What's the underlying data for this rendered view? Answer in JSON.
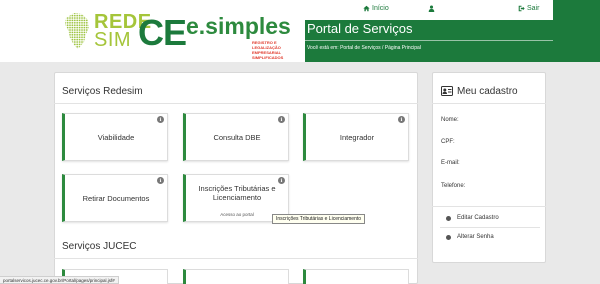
{
  "header": {
    "logo": {
      "rede": "REDE",
      "sim": "SIM",
      "ce": "CE",
      "esimples": "e.simples",
      "esimples_sub": "REGISTRO E LEGALIZAÇÃO EMPRESARIAL SIMPLIFICADOS"
    },
    "topbar": {
      "home_label": "Início",
      "logout_label": "Sair"
    },
    "portal_title": "Portal de Serviços",
    "breadcrumb": "Você está em: Portal de Serviços / Página Principal"
  },
  "main": {
    "section1_title": "Serviços Redesim",
    "cards": [
      {
        "label": "Viabilidade"
      },
      {
        "label": "Consulta DBE"
      },
      {
        "label": "Integrador"
      },
      {
        "label": "Retirar Documentos"
      },
      {
        "label": "Inscrições Tributárias e Licenciamento",
        "sub": "Acesso ao portal"
      }
    ],
    "tooltip": "Inscrições Tributárias e Licenciamento",
    "section2_title": "Serviços JUCEC"
  },
  "side": {
    "title": "Meu cadastro",
    "fields": {
      "name": "Nome:",
      "cpf": "CPF:",
      "email": "E-mail:",
      "phone": "Telefone:"
    },
    "links": {
      "edit": "Editar Cadastro",
      "password": "Alterar Senha"
    }
  },
  "status_url": "portalservicos.jucec.ce.gov.br/Portal/pages/principal.jsf#",
  "colors": {
    "brand_green": "#1c7a3c",
    "accent_green": "#2d8a3e",
    "lime": "#a5c53a"
  }
}
